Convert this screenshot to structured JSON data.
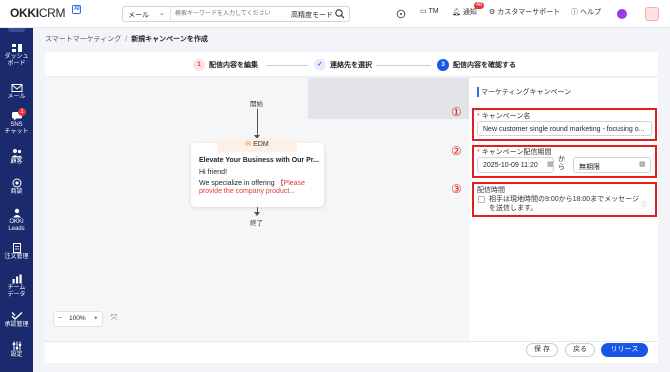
{
  "app": {
    "logo": "OKKI",
    "logo_crm": "CRM",
    "logo_badge": "AI"
  },
  "search": {
    "scope": "メール",
    "placeholder": "検索キーワードを入力してください",
    "mode": "高精度モード"
  },
  "topbar": {
    "tm": "TM",
    "notify": "通知",
    "notify_count": "48",
    "support": "カスタマーサポート",
    "help": "ヘルプ"
  },
  "sidebar": {
    "items": [
      {
        "label": "ダッシュ\nボード",
        "icon": "dashboard-icon"
      },
      {
        "label": "メール",
        "icon": "mail-icon"
      },
      {
        "label": "SNS\nチャット",
        "icon": "chat-icon",
        "badge": "1"
      },
      {
        "label": "顧客",
        "icon": "customers-icon"
      },
      {
        "label": "商談",
        "icon": "deals-icon"
      },
      {
        "label": "OKKI\nLeads",
        "icon": "leads-icon"
      },
      {
        "label": "注文管理",
        "icon": "orders-icon"
      },
      {
        "label": "チーム\nデータ",
        "icon": "team-data-icon"
      },
      {
        "label": "承認管理",
        "icon": "approval-icon"
      },
      {
        "label": "設定",
        "icon": "settings-icon"
      }
    ]
  },
  "breadcrumb": {
    "parent": "スマートマーケティング",
    "current": "新規キャンペーンを作成"
  },
  "steps": [
    {
      "num": "1",
      "label": "配信内容を編集"
    },
    {
      "num": "✓",
      "label": "連絡先を選択"
    },
    {
      "num": "3",
      "label": "配信内容を確認する"
    }
  ],
  "flow": {
    "start": "開始",
    "end": "終了",
    "node_type": "EDM",
    "email_title": "Elevate Your Business with Our Pr...",
    "greeting": "Hi friend!",
    "body_prefix": "We specialize in offering ",
    "body_highlight": "【Please provide the company product..."
  },
  "zoom": {
    "minus": "−",
    "value": "100%",
    "plus": "+"
  },
  "panel": {
    "title": "マーケティングキャンペーン",
    "name_label": "キャンペーン名",
    "name_value": "New customer single round marketing - focusing o...",
    "period_label": "キャンペーン配信期間",
    "start_date": "2025-10-09 11:20",
    "range_word": "から",
    "end_date": "無期限",
    "time_label": "配信時間",
    "time_option": "相手は現地時間の9:00から18:00までメッセージを送信します。"
  },
  "annotations": [
    "①",
    "②",
    "③"
  ],
  "footer": {
    "save": "保 存",
    "back": "戻る",
    "release": "リリース"
  }
}
